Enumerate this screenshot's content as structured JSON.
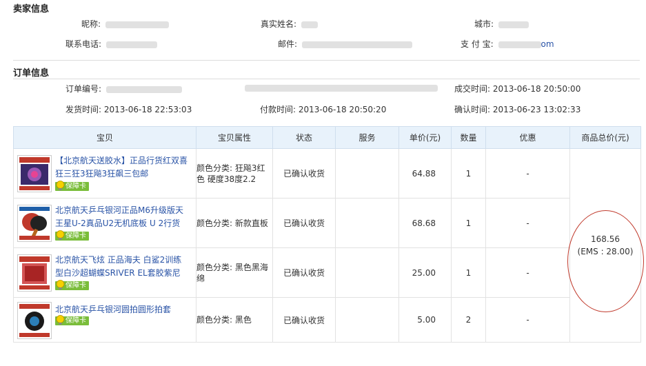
{
  "seller": {
    "title": "卖家信息",
    "nickname_label": "昵称:",
    "realname_label": "真实姓名:",
    "city_label": "城市:",
    "phone_label": "联系电话:",
    "email_label": "邮件:",
    "alipay_label": "支 付 宝:",
    "alipay_suffix": "om"
  },
  "order_info": {
    "title": "订单信息",
    "order_no_label": "订单编号:",
    "deal_time_label": "成交时间:",
    "deal_time": "2013-06-18 20:50:00",
    "ship_time_label": "发货时间:",
    "ship_time": "2013-06-18 22:53:03",
    "pay_time_label": "付款时间:",
    "pay_time": "2013-06-18 20:50:20",
    "confirm_time_label": "确认时间:",
    "confirm_time": "2013-06-23 13:02:33"
  },
  "table": {
    "headers": [
      "宝贝",
      "宝贝属性",
      "状态",
      "服务",
      "单价(元)",
      "数量",
      "优惠",
      "商品总价(元)"
    ],
    "rows": [
      {
        "title": "【北京航天送胶水】正品行货红双喜狂三狂3狂飚3狂飙三包邮",
        "guarantee": "保障卡",
        "attr": "颜色分类: 狂飚3红色 硬度38度2.2",
        "status": "已确认收货",
        "service": "",
        "price": "64.88",
        "qty": "1",
        "discount": "-"
      },
      {
        "title": "北京航天乒乓银河正品M6升级版天王星U-2真品U2无机底板 U 2行货",
        "guarantee": "保障卡",
        "attr": "颜色分类: 新款直板",
        "status": "已确认收货",
        "service": "",
        "price": "68.68",
        "qty": "1",
        "discount": "-"
      },
      {
        "title": "北京航天飞炫 正品海夫 白鲨2训练型白沙超蝴蝶SRIVER EL套胶紫尼",
        "guarantee": "保障卡",
        "attr": "颜色分类: 黑色黑海绵",
        "status": "已确认收货",
        "service": "",
        "price": "25.00",
        "qty": "1",
        "discount": "-"
      },
      {
        "title": "北京航天乒乓银河圆拍圆形拍套",
        "guarantee": "保障卡",
        "attr": "颜色分类: 黑色",
        "status": "已确认收货",
        "service": "",
        "price": "5.00",
        "qty": "2",
        "discount": "-"
      }
    ],
    "total": "168.56",
    "shipping": "(EMS : 28.00)"
  },
  "colors": {
    "link": "#2953a6",
    "header_bg": "#e8f2fb",
    "guarantee_green": "#7abd3a",
    "annotation_red": "#c0392b"
  }
}
